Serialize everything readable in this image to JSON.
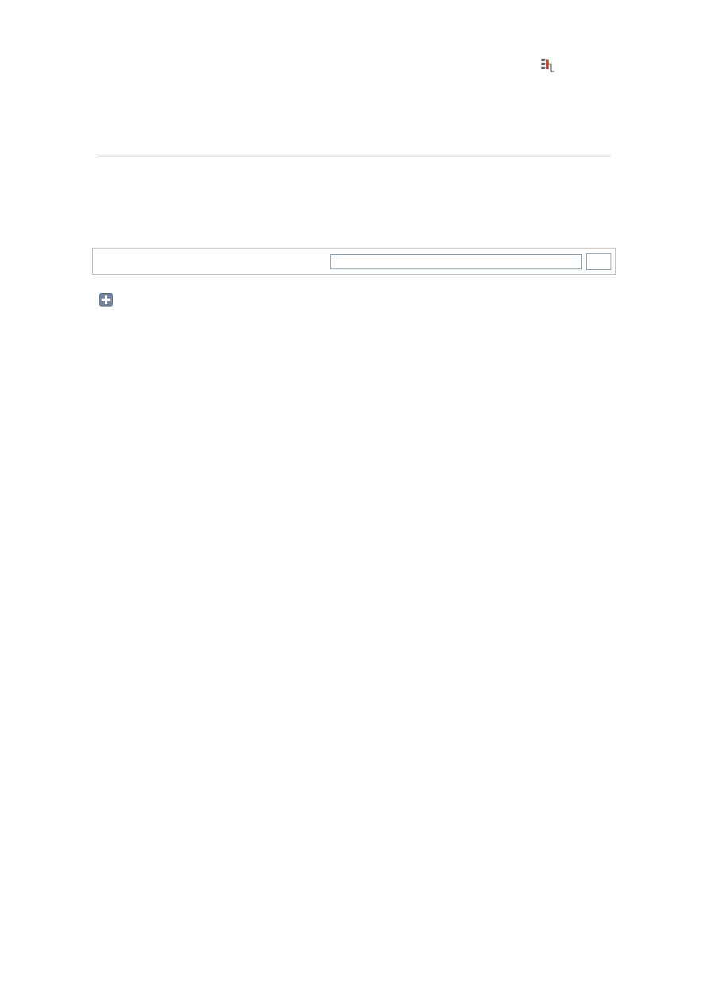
{
  "tree_toggle": {
    "expanded": false
  }
}
